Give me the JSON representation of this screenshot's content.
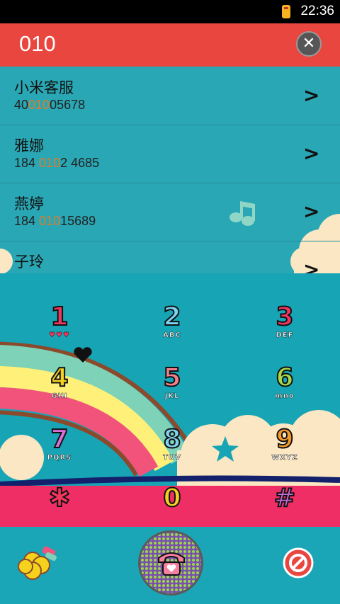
{
  "status_bar": {
    "time": "22:36"
  },
  "search": {
    "query": "010",
    "clear_icon": "close-icon"
  },
  "results": [
    {
      "name": "小米客服",
      "number_pre": "40",
      "number_hl": "010",
      "number_post": "05678"
    },
    {
      "name": "雅娜",
      "number_pre": "184 ",
      "number_hl": "010",
      "number_post": "2 4685"
    },
    {
      "name": "燕婷",
      "number_pre": "184 ",
      "number_hl": "010",
      "number_post": "15689"
    },
    {
      "name": "子玲",
      "number_pre": "",
      "number_hl": "",
      "number_post": ""
    }
  ],
  "keypad": [
    {
      "digit": "1",
      "letters": "♥♥♥",
      "color": "#f2365e"
    },
    {
      "digit": "2",
      "letters": "ABC",
      "color": "#7fd2f0"
    },
    {
      "digit": "3",
      "letters": "DEF",
      "color": "#f2365e"
    },
    {
      "digit": "4",
      "letters": "GHI",
      "color": "#f5d020"
    },
    {
      "digit": "5",
      "letters": "JKL",
      "color": "#f5808a"
    },
    {
      "digit": "6",
      "letters": "mno",
      "color": "#a8d84a"
    },
    {
      "digit": "7",
      "letters": "PQRS",
      "color": "#d96ed8"
    },
    {
      "digit": "8",
      "letters": "TUV",
      "color": "#7fd2f0"
    },
    {
      "digit": "9",
      "letters": "WXYZ",
      "color": "#f59a2a"
    },
    {
      "digit": "✱",
      "letters": "",
      "color": "#f2365e"
    },
    {
      "digit": "0",
      "letters": "",
      "color": "#f5d020"
    },
    {
      "digit": "#",
      "letters": "",
      "color": "#c86ad8"
    }
  ],
  "bottom_bar": {
    "left_icon": "flower-icon",
    "call_icon": "phone-icon",
    "right_icon": "no-entry-icon"
  },
  "colors": {
    "header": "#e8463f",
    "teal": "#2aa7b4",
    "highlight": "#e07b26"
  }
}
